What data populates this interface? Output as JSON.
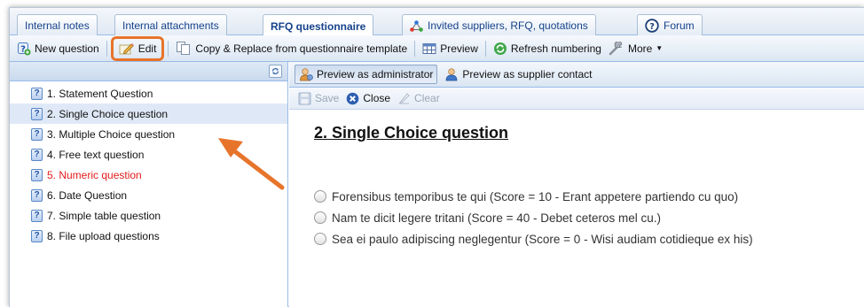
{
  "tabs": [
    {
      "label": "Internal notes",
      "active": false
    },
    {
      "label": "Internal attachments",
      "active": false
    },
    {
      "label": "RFQ questionnaire",
      "active": true
    },
    {
      "label": "Invited suppliers, RFQ, quotations",
      "active": false,
      "icon": "network-icon"
    },
    {
      "label": "Forum",
      "active": false,
      "icon": "help-circle-icon"
    }
  ],
  "toolbar": {
    "new_question": "New question",
    "edit": "Edit",
    "copy_replace": "Copy & Replace from questionnaire template",
    "preview": "Preview",
    "refresh_numbering": "Refresh numbering",
    "more": "More"
  },
  "tree": {
    "items": [
      {
        "label": "1. Statement Question",
        "selected": false,
        "highlight": false
      },
      {
        "label": "2. Single Choice question",
        "selected": true,
        "highlight": false
      },
      {
        "label": "3. Multiple Choice question",
        "selected": false,
        "highlight": false
      },
      {
        "label": "4. Free text question",
        "selected": false,
        "highlight": false
      },
      {
        "label": "5. Numeric question",
        "selected": false,
        "highlight": true
      },
      {
        "label": "6. Date Question",
        "selected": false,
        "highlight": false
      },
      {
        "label": "7. Simple table question",
        "selected": false,
        "highlight": false
      },
      {
        "label": "8. File upload questions",
        "selected": false,
        "highlight": false
      }
    ]
  },
  "preview_bar": {
    "as_admin": "Preview as administrator",
    "as_supplier": "Preview as supplier contact"
  },
  "action_bar": {
    "save": "Save",
    "close": "Close",
    "clear": "Clear"
  },
  "question": {
    "title": "2. Single Choice question",
    "options": [
      "Forensibus temporibus te qui (Score = 10 - Erant appetere partiendo cu quo)",
      "Nam te dicit legere tritani (Score = 40 - Debet ceteros mel cu.)",
      "Sea ei paulo adipiscing neglegentur (Score = 0 - Wisi audiam cotidieque ex his)"
    ]
  },
  "colors": {
    "accent_orange": "#e7742b",
    "link_blue": "#15428b",
    "error_red": "#e31b1b",
    "selection": "#dfe8f6"
  }
}
